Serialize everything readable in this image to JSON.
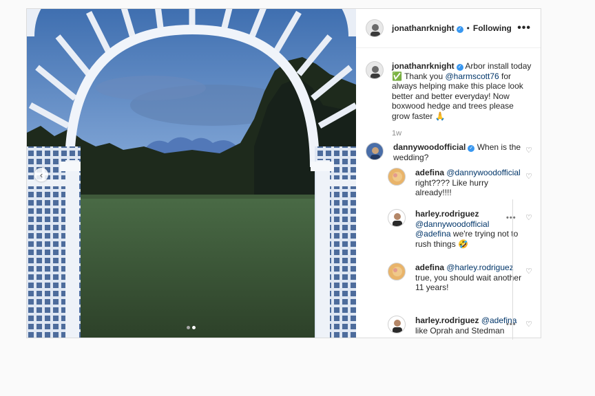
{
  "post": {
    "author": "jonathanrknight",
    "follow_separator": "•",
    "follow_status": "Following",
    "more_label": "•••",
    "carousel": {
      "current": 2,
      "total": 2,
      "prev_icon": "‹"
    }
  },
  "caption": {
    "username": "jonathanrknight",
    "text_1": "Arbor install today",
    "emoji_check": "✅",
    "text_2": "Thank you",
    "mention": "@harmscott76",
    "text_3": "for always helping make this place look better and better everyday! Now boxwood hedge and trees please grow faster",
    "emoji_pray": "🙏",
    "time": "1w"
  },
  "comments": [
    {
      "username": "dannywoodofficial",
      "verified": true,
      "text": "When is the wedding?"
    },
    {
      "username": "adefina",
      "mention": "@dannywoodofficial",
      "text": "right???? Like hurry already!!!!"
    },
    {
      "username": "harley.rodriguez",
      "mention_1": "@dannywoodofficial",
      "mention_2": "@adefina",
      "text": "we're trying not to rush things",
      "emoji": "🤣"
    },
    {
      "username": "adefina",
      "mention": "@harley.rodriguez",
      "text": "true, you should wait another 11 years!"
    },
    {
      "username": "harley.rodriguez",
      "mention": "@adefina",
      "text": "like Oprah and Stedman"
    }
  ],
  "icons": {
    "heart": "♡",
    "more": "•••",
    "verified": "✓"
  },
  "colors": {
    "link": "#003569",
    "verified": "#3897f0",
    "muted": "#8e8e8e"
  }
}
